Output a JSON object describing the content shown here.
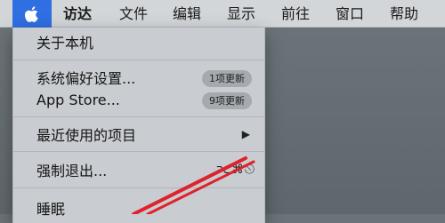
{
  "menubar": {
    "apple_icon": "apple-icon",
    "items": [
      "访达",
      "文件",
      "编辑",
      "显示",
      "前往",
      "窗口",
      "帮助"
    ]
  },
  "apple_menu": {
    "about": "关于本机",
    "system_prefs": {
      "label": "系统偏好设置...",
      "badge": "1项更新"
    },
    "app_store": {
      "label": "App Store...",
      "badge": "9项更新"
    },
    "recent_items": {
      "label": "最近使用的项目",
      "arrow": "▶"
    },
    "force_quit": {
      "label": "强制退出...",
      "shortcut": "⌥⌘⎋"
    },
    "sleep": "睡眠"
  },
  "colors": {
    "menubar_bg": "#d3d6d9",
    "apple_highlight": "#2f6fe2",
    "menu_bg": "#c9ccd0",
    "annotation": "#e0202a"
  }
}
